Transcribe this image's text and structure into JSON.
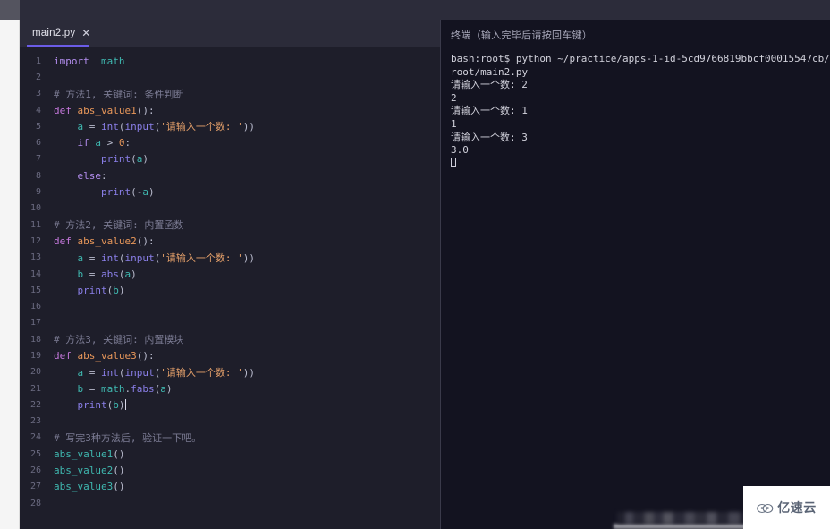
{
  "editor": {
    "tab": {
      "filename": "main2.py",
      "close_icon": "close-icon",
      "close_glyph": "✕"
    },
    "active_underline_color": "#6b5ce7",
    "background_color": "#1e1e2a",
    "lines": [
      {
        "n": "1",
        "tokens": [
          {
            "t": "kw",
            "s": "import"
          },
          {
            "t": "plain",
            "s": "  "
          },
          {
            "t": "mod",
            "s": "math"
          }
        ]
      },
      {
        "n": "2",
        "tokens": []
      },
      {
        "n": "3",
        "tokens": [
          {
            "t": "comment",
            "s": "# 方法1, 关键词: 条件判断"
          }
        ]
      },
      {
        "n": "4",
        "tokens": [
          {
            "t": "def",
            "s": "def"
          },
          {
            "t": "plain",
            "s": " "
          },
          {
            "t": "fn",
            "s": "abs_value1"
          },
          {
            "t": "punc",
            "s": "():"
          }
        ]
      },
      {
        "n": "5",
        "tokens": [
          {
            "t": "plain",
            "s": "    "
          },
          {
            "t": "var",
            "s": "a"
          },
          {
            "t": "op",
            "s": " = "
          },
          {
            "t": "builtin",
            "s": "int"
          },
          {
            "t": "punc",
            "s": "("
          },
          {
            "t": "builtin",
            "s": "input"
          },
          {
            "t": "punc",
            "s": "("
          },
          {
            "t": "str",
            "s": "'请输入一个数: '"
          },
          {
            "t": "punc",
            "s": "))"
          }
        ]
      },
      {
        "n": "6",
        "tokens": [
          {
            "t": "plain",
            "s": "    "
          },
          {
            "t": "kw",
            "s": "if"
          },
          {
            "t": "plain",
            "s": " "
          },
          {
            "t": "var",
            "s": "a"
          },
          {
            "t": "op",
            "s": " > "
          },
          {
            "t": "num",
            "s": "0"
          },
          {
            "t": "punc",
            "s": ":"
          }
        ]
      },
      {
        "n": "7",
        "tokens": [
          {
            "t": "plain",
            "s": "        "
          },
          {
            "t": "builtin",
            "s": "print"
          },
          {
            "t": "punc",
            "s": "("
          },
          {
            "t": "var",
            "s": "a"
          },
          {
            "t": "punc",
            "s": ")"
          }
        ]
      },
      {
        "n": "8",
        "tokens": [
          {
            "t": "plain",
            "s": "    "
          },
          {
            "t": "kw",
            "s": "else"
          },
          {
            "t": "punc",
            "s": ":"
          }
        ]
      },
      {
        "n": "9",
        "tokens": [
          {
            "t": "plain",
            "s": "        "
          },
          {
            "t": "builtin",
            "s": "print"
          },
          {
            "t": "punc",
            "s": "("
          },
          {
            "t": "op",
            "s": "-"
          },
          {
            "t": "var",
            "s": "a"
          },
          {
            "t": "punc",
            "s": ")"
          }
        ]
      },
      {
        "n": "10",
        "tokens": []
      },
      {
        "n": "11",
        "tokens": [
          {
            "t": "comment",
            "s": "# 方法2, 关键词: 内置函数"
          }
        ]
      },
      {
        "n": "12",
        "tokens": [
          {
            "t": "def",
            "s": "def"
          },
          {
            "t": "plain",
            "s": " "
          },
          {
            "t": "fn",
            "s": "abs_value2"
          },
          {
            "t": "punc",
            "s": "():"
          }
        ]
      },
      {
        "n": "13",
        "tokens": [
          {
            "t": "plain",
            "s": "    "
          },
          {
            "t": "var",
            "s": "a"
          },
          {
            "t": "op",
            "s": " = "
          },
          {
            "t": "builtin",
            "s": "int"
          },
          {
            "t": "punc",
            "s": "("
          },
          {
            "t": "builtin",
            "s": "input"
          },
          {
            "t": "punc",
            "s": "("
          },
          {
            "t": "str",
            "s": "'请输入一个数: '"
          },
          {
            "t": "punc",
            "s": "))"
          }
        ]
      },
      {
        "n": "14",
        "tokens": [
          {
            "t": "plain",
            "s": "    "
          },
          {
            "t": "var",
            "s": "b"
          },
          {
            "t": "op",
            "s": " = "
          },
          {
            "t": "builtin",
            "s": "abs"
          },
          {
            "t": "punc",
            "s": "("
          },
          {
            "t": "var",
            "s": "a"
          },
          {
            "t": "punc",
            "s": ")"
          }
        ]
      },
      {
        "n": "15",
        "tokens": [
          {
            "t": "plain",
            "s": "    "
          },
          {
            "t": "builtin",
            "s": "print"
          },
          {
            "t": "punc",
            "s": "("
          },
          {
            "t": "var",
            "s": "b"
          },
          {
            "t": "punc",
            "s": ")"
          }
        ]
      },
      {
        "n": "16",
        "tokens": []
      },
      {
        "n": "17",
        "tokens": []
      },
      {
        "n": "18",
        "tokens": [
          {
            "t": "comment",
            "s": "# 方法3, 关键词: 内置模块"
          }
        ]
      },
      {
        "n": "19",
        "tokens": [
          {
            "t": "def",
            "s": "def"
          },
          {
            "t": "plain",
            "s": " "
          },
          {
            "t": "fn",
            "s": "abs_value3"
          },
          {
            "t": "punc",
            "s": "():"
          }
        ]
      },
      {
        "n": "20",
        "tokens": [
          {
            "t": "plain",
            "s": "    "
          },
          {
            "t": "var",
            "s": "a"
          },
          {
            "t": "op",
            "s": " = "
          },
          {
            "t": "builtin",
            "s": "int"
          },
          {
            "t": "punc",
            "s": "("
          },
          {
            "t": "builtin",
            "s": "input"
          },
          {
            "t": "punc",
            "s": "("
          },
          {
            "t": "str",
            "s": "'请输入一个数: '"
          },
          {
            "t": "punc",
            "s": "))"
          }
        ]
      },
      {
        "n": "21",
        "tokens": [
          {
            "t": "plain",
            "s": "    "
          },
          {
            "t": "var",
            "s": "b"
          },
          {
            "t": "op",
            "s": " = "
          },
          {
            "t": "mod",
            "s": "math"
          },
          {
            "t": "punc",
            "s": "."
          },
          {
            "t": "attr",
            "s": "fabs"
          },
          {
            "t": "punc",
            "s": "("
          },
          {
            "t": "var",
            "s": "a"
          },
          {
            "t": "punc",
            "s": ")"
          }
        ]
      },
      {
        "n": "22",
        "tokens": [
          {
            "t": "plain",
            "s": "    "
          },
          {
            "t": "builtin",
            "s": "print"
          },
          {
            "t": "punc",
            "s": "("
          },
          {
            "t": "var",
            "s": "b"
          },
          {
            "t": "punc",
            "s": ")"
          }
        ],
        "caret": true
      },
      {
        "n": "23",
        "tokens": []
      },
      {
        "n": "24",
        "tokens": [
          {
            "t": "comment",
            "s": "# 写完3种方法后, 验证一下吧。"
          }
        ]
      },
      {
        "n": "25",
        "tokens": [
          {
            "t": "fn2",
            "s": "abs_value1"
          },
          {
            "t": "punc",
            "s": "()"
          }
        ]
      },
      {
        "n": "26",
        "tokens": [
          {
            "t": "fn2",
            "s": "abs_value2"
          },
          {
            "t": "punc",
            "s": "()"
          }
        ]
      },
      {
        "n": "27",
        "tokens": [
          {
            "t": "fn2",
            "s": "abs_value3"
          },
          {
            "t": "punc",
            "s": "()"
          }
        ]
      },
      {
        "n": "28",
        "tokens": []
      }
    ]
  },
  "terminal": {
    "header": "终端（输入完毕后请按回车键）",
    "background_color": "#131320",
    "output": [
      "bash:root$ python ~/practice/apps-1-id-5cd9766819bbcf00015547cb/root/main2.py",
      "请输入一个数: 2",
      "2",
      "请输入一个数: 1",
      "1",
      "请输入一个数: 3",
      "3.0"
    ],
    "cursor": "block-cursor"
  },
  "watermark": {
    "text": "亿速云",
    "icon": "cloud-icon"
  }
}
